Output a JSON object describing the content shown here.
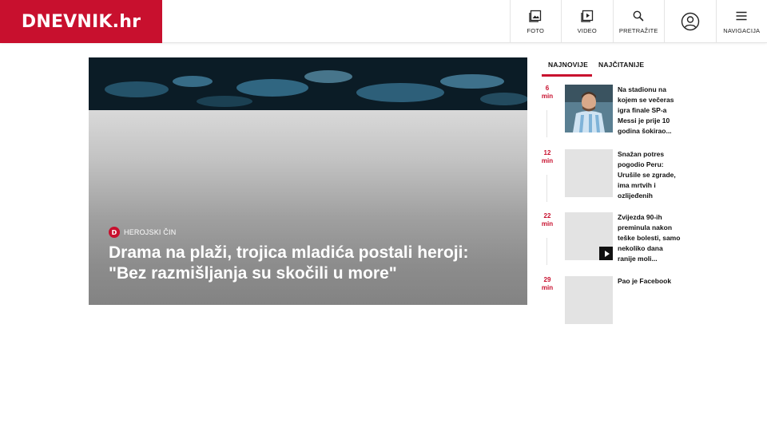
{
  "brand": {
    "logo_text": "DNEVNIK.hr",
    "color": "#c8102e"
  },
  "nav": [
    {
      "label": "FOTO",
      "icon": "photo-icon"
    },
    {
      "label": "VIDEO",
      "icon": "video-icon"
    },
    {
      "label": "PRETRAŽITE",
      "icon": "search-icon"
    },
    {
      "label": "",
      "icon": "user-icon"
    },
    {
      "label": "NAVIGACIJA",
      "icon": "menu-icon"
    }
  ],
  "hero": {
    "category": "HEROJSKI ČIN",
    "badge": "D",
    "title": "Drama na plaži, trojica mladića postali heroji: \"Bez razmišljanja su skočili u more\""
  },
  "sidebar": {
    "tabs": [
      "NAJNOVIJE",
      "NAJČITANIJE"
    ],
    "active_tab": "NAJNOVIJE",
    "items": [
      {
        "time_value": "6",
        "time_unit": "min",
        "headline": "Na stadionu na kojem se večeras igra finale SP-a Messi je prije 10 godina šokirao...",
        "has_video": false
      },
      {
        "time_value": "12",
        "time_unit": "min",
        "headline": "Snažan potres pogodio Peru: Urušile se zgrade, ima mrtvih i ozlijeđenih",
        "has_video": false
      },
      {
        "time_value": "22",
        "time_unit": "min",
        "headline": "Zvijezda 90-ih preminula nakon teške bolesti, samo nekoliko dana ranije moli...",
        "has_video": true
      },
      {
        "time_value": "29",
        "time_unit": "min",
        "headline": "Pao je Facebook",
        "has_video": false
      }
    ]
  }
}
